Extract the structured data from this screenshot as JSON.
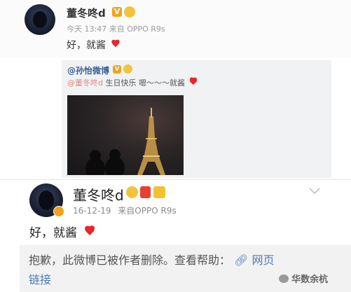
{
  "top_post": {
    "username": "董冬咚d",
    "badge_v": "V",
    "time": "今天 13:47",
    "source": "来自 OPPO R9s",
    "text": "好，就酱"
  },
  "repost": {
    "username": "@孙怡微博",
    "badge_v": "V",
    "mention": "@董冬咚d",
    "text": "生日快乐  嗯～～～就酱"
  },
  "bottom_post": {
    "username": "董冬咚d",
    "date": "16-12-19",
    "source": "来自OPPO R9s",
    "text": "好，就酱",
    "deleted_notice": "抱歉，此微博已被作者删除。查看帮助：",
    "link_word1": "网页",
    "link_word2": "链接"
  },
  "watermark": {
    "text": "华数余杭"
  },
  "colors": {
    "heart": "#e8262c",
    "vip_badge": "#f3a21b",
    "link": "#4a7ab5"
  }
}
